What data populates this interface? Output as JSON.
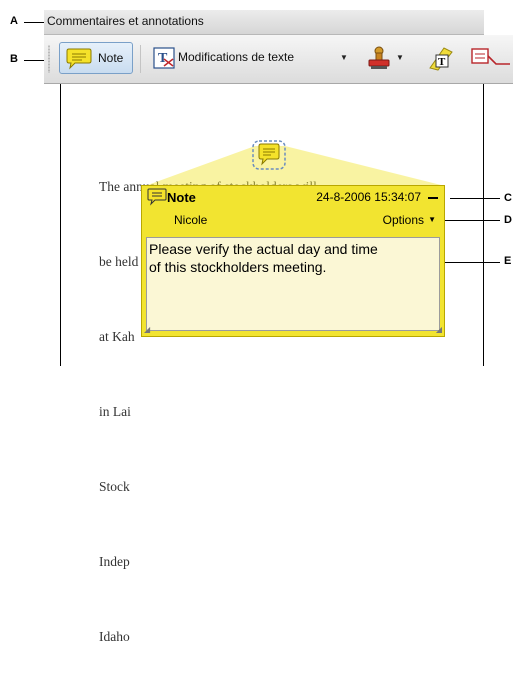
{
  "callouts": {
    "a": "A",
    "b": "B",
    "c": "C",
    "d": "D",
    "e": "E"
  },
  "titlebar": {
    "title": "Commentaires et annotations"
  },
  "toolbar": {
    "note_label": "Note",
    "text_edits_label": "Modifications de texte",
    "icons": [
      "note-icon",
      "text-edits-icon",
      "stamp-icon",
      "highlight-text-icon",
      "callout-icon"
    ]
  },
  "document": {
    "lines": [
      "The annual meeting of stockholders will",
      "be held April 30, at 9 a.m. Pacific Time",
      "at Kah",
      "in Lai",
      "Stock",
      "Indep",
      "Idaho"
    ]
  },
  "note_popup": {
    "title": "Note",
    "timestamp": "24-8-2006 15:34:07",
    "author": "Nicole",
    "options_label": "Options",
    "body_line1": "Please verify the actual day and time",
    "body_line2": "of this stockholders meeting."
  },
  "colors": {
    "note_yellow": "#f2e430",
    "note_body": "#fbf7d5",
    "selected_button": "#c9dcf0"
  }
}
